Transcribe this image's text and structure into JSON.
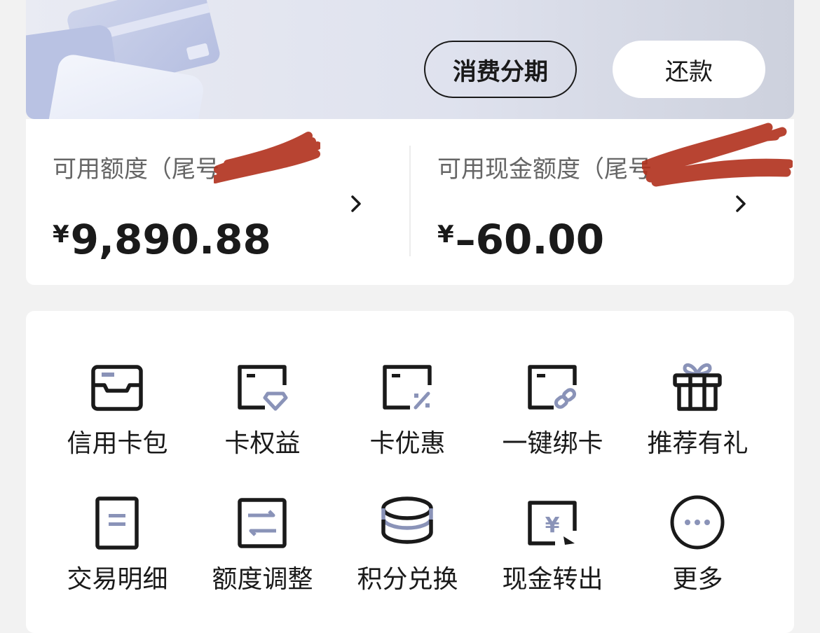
{
  "banner": {
    "installment_label": "消费分期",
    "repay_label": "还款"
  },
  "credit": {
    "available": {
      "label": "可用额度（尾号",
      "amount": "9,890.88",
      "currency": "¥"
    },
    "cash": {
      "label": "可用现金额度（尾号",
      "amount": "–60.00",
      "currency": "¥"
    }
  },
  "colors": {
    "accent": "#8a93b8",
    "dark": "#1a1a1a",
    "redact": "#b0301c"
  },
  "services": [
    {
      "label": "信用卡包",
      "icon": "card-wallet-icon"
    },
    {
      "label": "卡权益",
      "icon": "card-benefit-icon"
    },
    {
      "label": "卡优惠",
      "icon": "card-discount-icon"
    },
    {
      "label": "一键绑卡",
      "icon": "card-bind-icon"
    },
    {
      "label": "推荐有礼",
      "icon": "gift-icon"
    },
    {
      "label": "交易明细",
      "icon": "transaction-detail-icon"
    },
    {
      "label": "额度调整",
      "icon": "limit-adjust-icon"
    },
    {
      "label": "积分兑换",
      "icon": "points-coins-icon"
    },
    {
      "label": "现金转出",
      "icon": "cash-transfer-icon"
    },
    {
      "label": "更多",
      "icon": "more-icon"
    }
  ]
}
